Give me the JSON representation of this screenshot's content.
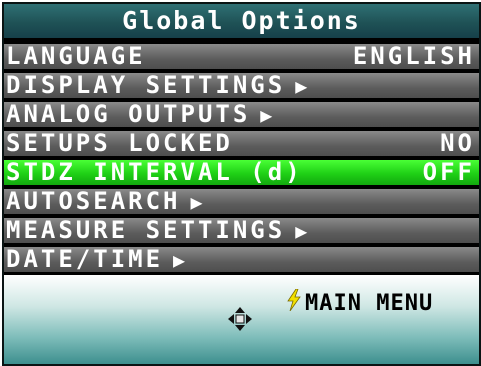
{
  "header": {
    "title": "Global Options"
  },
  "menu": {
    "items": [
      {
        "label": "LANGUAGE",
        "value": "ENGLISH",
        "arrow": ""
      },
      {
        "label": "DISPLAY SETTINGS",
        "value": "",
        "arrow": "▶"
      },
      {
        "label": "ANALOG OUTPUTS",
        "value": "",
        "arrow": "▶"
      },
      {
        "label": "SETUPS LOCKED",
        "value": "NO",
        "arrow": ""
      },
      {
        "label": "STDZ INTERVAL (d)",
        "value": "OFF",
        "arrow": ""
      },
      {
        "label": "AUTOSEARCH",
        "value": "",
        "arrow": "▶"
      },
      {
        "label": "MEASURE SETTINGS",
        "value": "",
        "arrow": "▶"
      },
      {
        "label": "DATE/TIME",
        "value": "",
        "arrow": "▶"
      }
    ],
    "selected_label": "STDZ INTERVAL (d)"
  },
  "footer": {
    "main_menu_label": "MAIN MENU"
  },
  "icons": {
    "main_menu": "lightning-icon",
    "navigation": "dpad-icon"
  },
  "colors": {
    "title_bar": "#1f5256",
    "row_gray": "#6a6a6a",
    "row_selected": "#2ee11f",
    "accent_bolt": "#f2e100",
    "footer_teal": "#3d8f8e"
  }
}
